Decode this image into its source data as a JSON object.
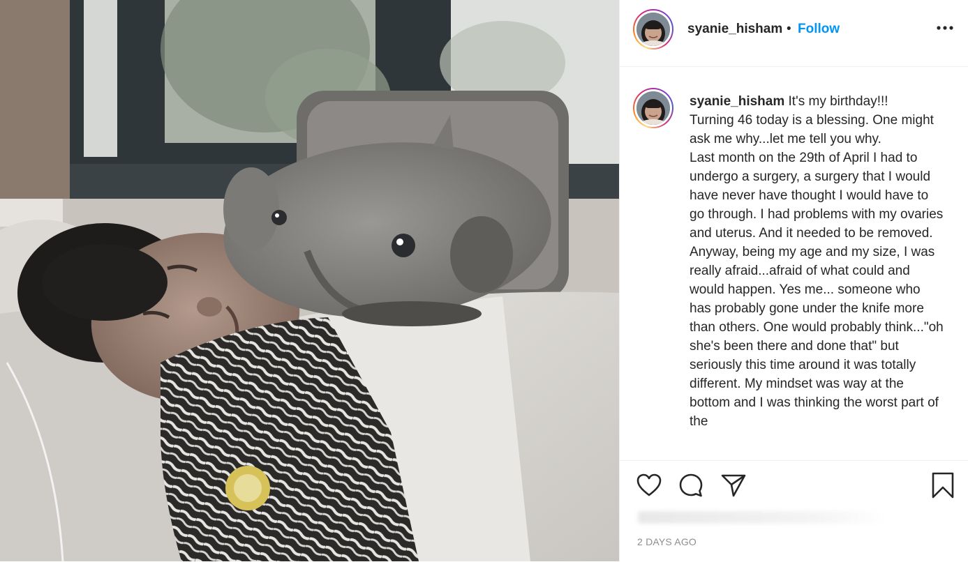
{
  "post": {
    "username": "syanie_hisham",
    "separator": "•",
    "follow_label": "Follow",
    "more_icon": "more-horizontal-icon",
    "caption_user": "syanie_hisham",
    "caption_text": " It's my birthday!!!\nTurning 46 today is a blessing. One might ask me why...let me tell you why.\nLast month on the 29th of April I had to undergo a surgery, a surgery that I would have never have thought I would have to go through. I had problems with my ovaries and uterus. And it needed to be removed. Anyway, being my age and my size, I was really afraid...afraid of what could and would happen. Yes me... someone who has probably gone under the knife more than others. One would probably think...\"oh she's been there and done that\" but seriously this time around it was totally different. My mindset was way at the bottom and I was thinking the worst part of the",
    "timestamp": "2 DAYS AGO"
  },
  "icons": {
    "like": "heart-icon",
    "comment": "comment-icon",
    "share": "send-icon",
    "save": "bookmark-icon"
  },
  "colors": {
    "link": "#0095f6",
    "text": "#262626",
    "muted": "#8e8e8e",
    "border": "#efefef"
  }
}
